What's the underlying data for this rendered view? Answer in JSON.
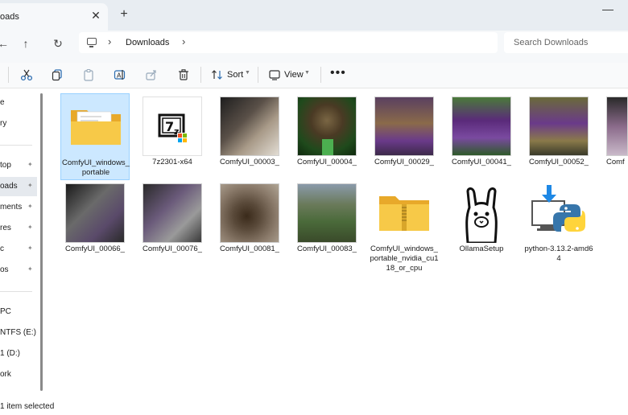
{
  "window": {
    "tab_title": "oads",
    "tab_close": "✕",
    "new_tab": "+",
    "minimize": "—"
  },
  "address": {
    "back": "←",
    "up": "↑",
    "refresh": "↻",
    "separator": "›",
    "crumb": "Downloads",
    "search_placeholder": "Search Downloads"
  },
  "toolbar": {
    "sort_label": "Sort",
    "view_label": "View",
    "more_label": "•••"
  },
  "sidebar": {
    "items": [
      {
        "label": "e",
        "pinned": false
      },
      {
        "label": "ry",
        "pinned": false
      },
      {
        "label": "top",
        "pinned": true
      },
      {
        "label": "oads",
        "pinned": true,
        "selected": true
      },
      {
        "label": "ments",
        "pinned": true
      },
      {
        "label": "res",
        "pinned": true
      },
      {
        "label": "c",
        "pinned": true
      },
      {
        "label": "os",
        "pinned": true
      },
      {
        "label": "PC",
        "pinned": false
      },
      {
        "label": "NTFS (E:)",
        "pinned": false
      },
      {
        "label": "1 (D:)",
        "pinned": false
      },
      {
        "label": "ork",
        "pinned": false
      }
    ],
    "pin_glyph": "📌"
  },
  "files": [
    {
      "name": "ComfyUI_windows_portable",
      "kind": "folder",
      "selected": true
    },
    {
      "name": "7z2301-x64",
      "kind": "installer-7z"
    },
    {
      "name": "ComfyUI_00003_",
      "kind": "photo",
      "colors": [
        "#2b2b2b",
        "#8a7a66",
        "#d9d4cc"
      ]
    },
    {
      "name": "ComfyUI_00004_",
      "kind": "photo",
      "colors": [
        "#1f4a1c",
        "#6b5a3a",
        "#4caf50"
      ]
    },
    {
      "name": "ComfyUI_00029_",
      "kind": "photo",
      "colors": [
        "#3d2a4a",
        "#7a5a3a",
        "#6a3a8a"
      ]
    },
    {
      "name": "ComfyUI_00041_",
      "kind": "photo",
      "colors": [
        "#2e5a2a",
        "#5a2a7a",
        "#7a4aa0"
      ]
    },
    {
      "name": "ComfyUI_00052_",
      "kind": "photo",
      "colors": [
        "#4a4a2a",
        "#6a3a8a",
        "#8a7a4a"
      ]
    },
    {
      "name": "Comf",
      "kind": "photo",
      "colors": [
        "#3a3a3a",
        "#8a6a8a",
        "#c9b9c9"
      ]
    },
    {
      "name": "ComfyUI_00066_",
      "kind": "photo",
      "colors": [
        "#2a2a2a",
        "#7a7a7a",
        "#5a4a6a"
      ]
    },
    {
      "name": "ComfyUI_00076_",
      "kind": "photo",
      "colors": [
        "#3a3a3a",
        "#6a5a7a",
        "#9a9a9a"
      ]
    },
    {
      "name": "ComfyUI_00081_",
      "kind": "photo",
      "colors": [
        "#5a4a3a",
        "#8a7a6a",
        "#3a2a1a"
      ]
    },
    {
      "name": "ComfyUI_00083_",
      "kind": "photo",
      "colors": [
        "#4a6a3a",
        "#8a9aaa",
        "#3a4a2a"
      ]
    },
    {
      "name": "ComfyUI_windows_portable_nvidia_cu118_or_cpu",
      "kind": "zip-folder"
    },
    {
      "name": "OllamaSetup",
      "kind": "ollama"
    },
    {
      "name": "python-3.13.2-amd64",
      "kind": "python-installer"
    }
  ],
  "status": {
    "text": "1 item selected"
  },
  "colors": {
    "folder_front": "#f7c948",
    "folder_back": "#e8a92a",
    "selection_bg": "#cce8ff",
    "download_arrow": "#1e88e5",
    "python_blue": "#3776ab",
    "python_yellow": "#ffd43b"
  }
}
